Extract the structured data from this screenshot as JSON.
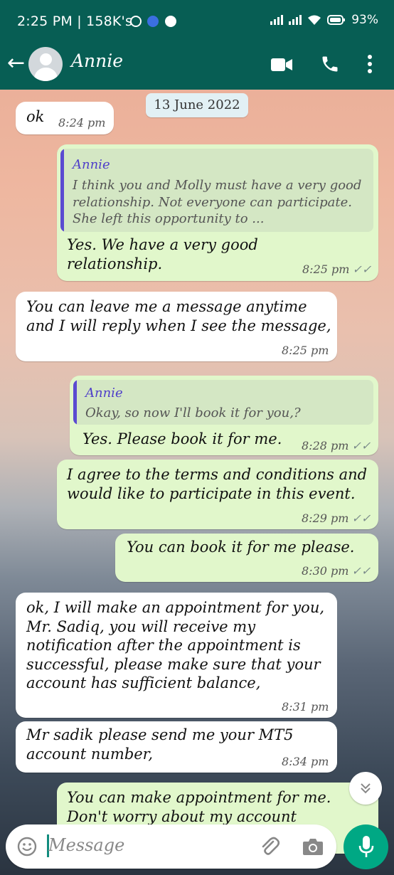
{
  "status_bar": {
    "time_text": "2:25 PM | 158K's",
    "battery": "93%",
    "icons": [
      "clock-icon",
      "message-icon",
      "messenger-icon",
      "signal-icon",
      "signal-icon",
      "wifi-icon",
      "battery-icon"
    ]
  },
  "app_bar": {
    "contact_name": "Annie",
    "icons": [
      "back-arrow-icon",
      "avatar-icon",
      "video-call-icon",
      "phone-icon",
      "more-vert-icon"
    ],
    "color": "#075e54"
  },
  "chat": {
    "date_chip": "13 June 2022",
    "messages": [
      {
        "dir": "in",
        "text": "ok",
        "time": "8:24 pm"
      },
      {
        "dir": "out",
        "quote": {
          "name": "Annie",
          "text": "I think you and Molly must have a very good relationship. Not everyone can participate. She left this opportunity to ..."
        },
        "text": "Yes. We have a very good relationship.",
        "time": "8:25 pm"
      },
      {
        "dir": "in",
        "text": "You can leave me a message anytime and I will reply when I see the message,",
        "time": "8:25 pm"
      },
      {
        "dir": "out",
        "quote": {
          "name": "Annie",
          "text": "Okay, so now I'll book it for you,?"
        },
        "text": "Yes. Please book it for me.",
        "time": "8:28 pm"
      },
      {
        "dir": "out",
        "text": "I agree to the terms and conditions and would like to participate in this event.",
        "time": "8:29 pm"
      },
      {
        "dir": "out",
        "text": "You can book it for me please.",
        "time": "8:30 pm"
      },
      {
        "dir": "in",
        "text": "ok, I will make an appointment for you, Mr. Sadiq, you will receive my notification after the appointment is successful, please make sure that your account has sufficient balance,",
        "time": "8:31 pm"
      },
      {
        "dir": "in",
        "text": "Mr sadik please send me your MT5 account number,",
        "time": "8:34 pm"
      },
      {
        "dir": "out",
        "text": "You can make  appointment for me. Don't  worry about my account",
        "time": ""
      }
    ],
    "tick_icon": "double-check-icon",
    "scroll_down_icon": "double-chevron-down-icon",
    "incoming_color": "#ffffff",
    "outgoing_color": "#e1f7cb"
  },
  "input_bar": {
    "placeholder": "Message",
    "icons": [
      "emoji-icon",
      "attach-icon",
      "camera-icon",
      "mic-icon"
    ],
    "accent": "#00a884"
  }
}
